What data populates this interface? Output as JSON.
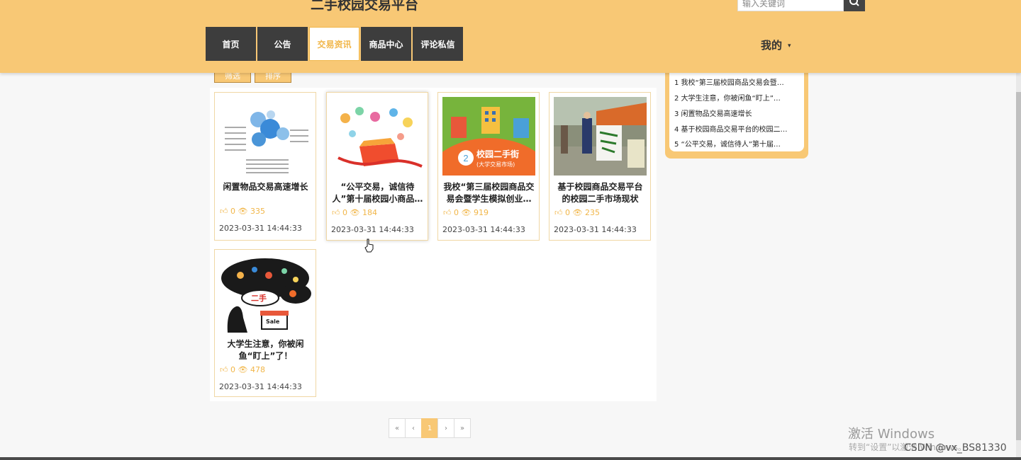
{
  "header": {
    "site_title": "二手校园交易平台",
    "search_placeholder": "输入关键词",
    "nav": [
      "首页",
      "公告",
      "交易资讯",
      "商品中心",
      "评论私信"
    ],
    "active_nav": "交易资讯",
    "user_menu": "我的",
    "caret": "▾"
  },
  "filters": [
    "筛选",
    "排序"
  ],
  "cards": [
    {
      "title": "闲置物品交易高速增长",
      "likes": "0",
      "views": "335",
      "date": "2023-03-31 14:44:33"
    },
    {
      "title": "“公平交易，诚信待人”第十届校园小商品…",
      "likes": "0",
      "views": "184",
      "date": "2023-03-31 14:44:33"
    },
    {
      "title": "我校“第三届校园商品交易会暨学生模拟创业…",
      "likes": "0",
      "views": "919",
      "date": "2023-03-31 14:44:33",
      "thumb_text": "校园二手街",
      "thumb_sub": "(大学交易市场)"
    },
    {
      "title": "基于校园商品交易平台的校园二手市场现状",
      "likes": "0",
      "views": "235",
      "date": "2023-03-31 14:44:33"
    },
    {
      "title": "大学生注意，你被闲鱼“盯上”了！",
      "likes": "0",
      "views": "478",
      "date": "2023-03-31 14:44:33",
      "thumb_text": "二手",
      "thumb_sale": "Sale"
    }
  ],
  "sidebar": {
    "items": [
      "1 我校“第三届校园商品交易会暨…",
      "2 大学生注意，你被闲鱼“盯上”…",
      "3 闲置物品交易高速增长",
      "4 基于校园商品交易平台的校园二…",
      "5 “公平交易，诚信待人”第十届…"
    ]
  },
  "pagination": [
    "«",
    "‹",
    "1",
    "›",
    "»"
  ],
  "overlay": {
    "win_title": "激活 Windows",
    "win_sub": "转到“设置”以激活 Windows。",
    "watermark": "CSDN @vx_BS81330"
  },
  "colors": {
    "brand": "#f8c875",
    "nav_dark": "#3d3d3d",
    "accent": "#f1b649"
  }
}
